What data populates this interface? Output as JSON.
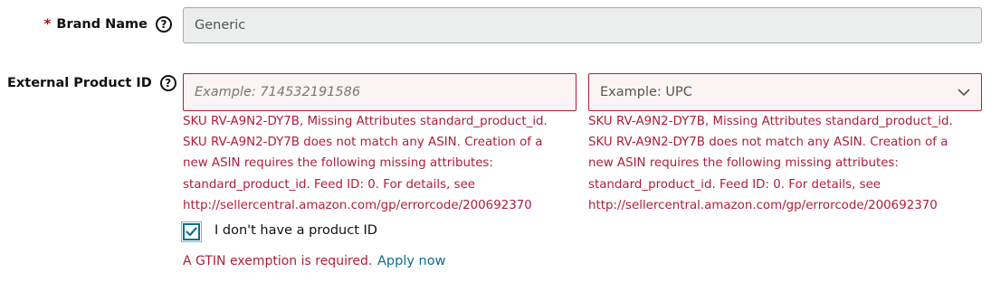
{
  "brand": {
    "required_marker": "*",
    "label": "Brand Name",
    "help_glyph": "?",
    "value": "Generic"
  },
  "product_id": {
    "label": "External Product ID",
    "help_glyph": "?",
    "placeholder": "Example: 714532191586",
    "value": "",
    "type_select": {
      "selected": "Example: UPC",
      "icon": "chevron-down-icon"
    },
    "errors_left": [
      "SKU RV-A9N2-DY7B, Missing Attributes standard_product_id.",
      "SKU RV-A9N2-DY7B does not match any ASIN. Creation of a",
      "new ASIN requires the following missing attributes:",
      "standard_product_id. Feed ID: 0. For details, see",
      "http://sellercentral.amazon.com/gp/errorcode/200692370"
    ],
    "errors_right": [
      "SKU RV-A9N2-DY7B, Missing Attributes standard_product_id.",
      "SKU RV-A9N2-DY7B does not match any ASIN. Creation of a",
      "new ASIN requires the following missing attributes:",
      "standard_product_id. Feed ID: 0. For details, see",
      "http://sellercentral.amazon.com/gp/errorcode/200692370"
    ]
  },
  "no_product_id": {
    "checked": true,
    "label": "I don't have a product ID"
  },
  "gtin": {
    "message": "A GTIN exemption is required.",
    "link": "Apply now"
  },
  "colors": {
    "error": "#b01d3a",
    "link": "#0f6b8a",
    "checkbox_accent": "#0e6e8e"
  }
}
